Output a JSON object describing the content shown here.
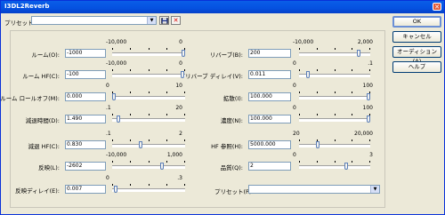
{
  "window": {
    "title": "I3DL2Reverb",
    "close": "✕"
  },
  "top": {
    "preset_label": "プリセット:",
    "preset_value": "",
    "save_icon": "save-icon",
    "delete_icon": "delete-icon"
  },
  "buttons": {
    "ok": "OK",
    "cancel": "キャンセル",
    "audition": "オーディション(A)",
    "help": "ヘルプ"
  },
  "params_left": [
    {
      "label": "ルーム(O):",
      "value": "-1000",
      "min": "-10,000",
      "max": "0",
      "pos": 1.0
    },
    {
      "label": "ルーム HF(C):",
      "value": "-100",
      "min": "-10,000",
      "max": "0",
      "pos": 0.99
    },
    {
      "label": "ルーム ロールオフ(M):",
      "value": "0.000",
      "min": "0",
      "max": "10",
      "pos": 0.0
    },
    {
      "label": "減退時間(D):",
      "value": "1.490",
      "min": ".1",
      "max": "20",
      "pos": 0.07
    },
    {
      "label": "減退 HF(C):",
      "value": "0.830",
      "min": ".1",
      "max": "2",
      "pos": 0.38
    },
    {
      "label": "反映(L):",
      "value": "-2602",
      "min": "-10,000",
      "max": "1,000",
      "pos": 0.69
    },
    {
      "label": "反映ディレイ(E):",
      "value": "0.007",
      "min": "0",
      "max": ".3",
      "pos": 0.02
    }
  ],
  "params_right": [
    {
      "label": "リバーブ(B):",
      "value": "200",
      "min": "-10,000",
      "max": "2,000",
      "pos": 0.85
    },
    {
      "label": "リバーブ ディレイ(V):",
      "value": "0.011",
      "min": "0",
      "max": ".1",
      "pos": 0.11
    },
    {
      "label": "拡散(I):",
      "value": "100.000",
      "min": "0",
      "max": "100",
      "pos": 1.0
    },
    {
      "label": "濃度(N):",
      "value": "100.000",
      "min": "0",
      "max": "100",
      "pos": 1.0
    },
    {
      "label": "HF 参照(H):",
      "value": "5000.000",
      "min": "20",
      "max": "20,000",
      "pos": 0.25
    },
    {
      "label": "品質(Q):",
      "value": "2",
      "min": "0",
      "max": "3",
      "pos": 0.67
    }
  ],
  "bottom_preset": {
    "label": "プリセット(P):",
    "value": ""
  }
}
